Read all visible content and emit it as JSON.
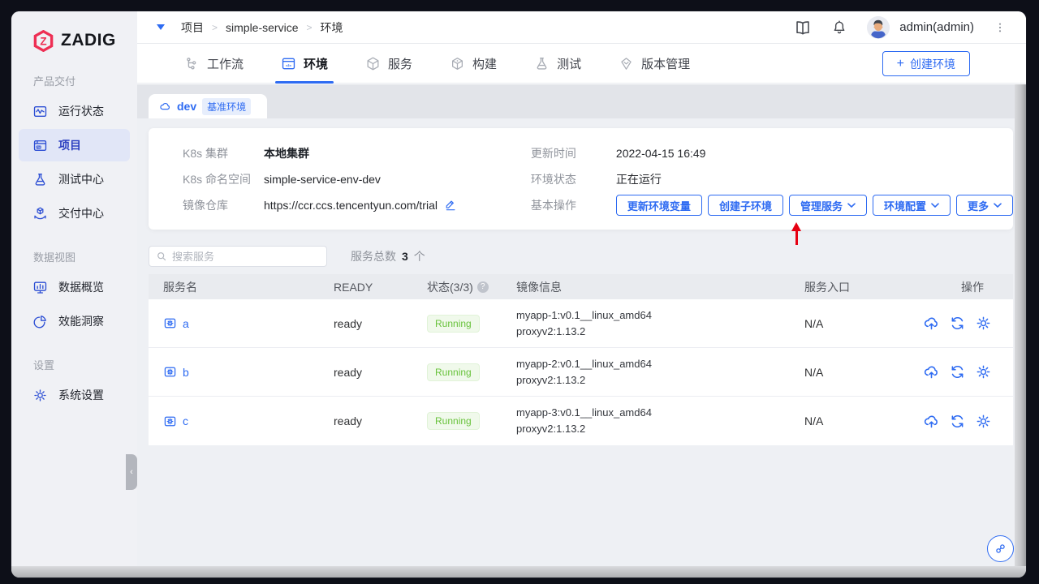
{
  "brand": {
    "name": "ZADIG",
    "logo_icon": "zadig-logo-icon",
    "logo_color": "#ee2f54"
  },
  "sidebar": {
    "sections": [
      {
        "title": "产品交付",
        "items": [
          {
            "icon": "monitor-wave-icon",
            "label": "运行状态",
            "active": false
          },
          {
            "icon": "project-icon",
            "label": "项目",
            "active": true
          },
          {
            "icon": "test-flask-icon",
            "label": "测试中心",
            "active": false
          },
          {
            "icon": "delivery-box-icon",
            "label": "交付中心",
            "active": false
          }
        ]
      },
      {
        "title": "数据视图",
        "items": [
          {
            "icon": "chart-monitor-icon",
            "label": "数据概览",
            "active": false
          },
          {
            "icon": "pie-chart-icon",
            "label": "效能洞察",
            "active": false
          }
        ]
      },
      {
        "title": "设置",
        "items": [
          {
            "icon": "gear-icon",
            "label": "系统设置",
            "active": false
          }
        ]
      }
    ],
    "collapse_icon": "chevron-left-icon"
  },
  "topbar": {
    "breadcrumb": {
      "caret_icon": "caret-down-icon",
      "items": [
        "项目",
        "simple-service",
        "环境"
      ]
    },
    "doc_icon": "docs-book-icon",
    "bell_icon": "notifications-bell-icon",
    "user": {
      "name": "admin(admin)",
      "avatar_icon": "user-avatar"
    },
    "more_icon": "kebab-menu-icon"
  },
  "tabs": {
    "items": [
      {
        "icon": "workflow-icon",
        "label": "工作流",
        "active": false
      },
      {
        "icon": "environment-icon",
        "label": "环境",
        "active": true
      },
      {
        "icon": "services-cube-icon",
        "label": "服务",
        "active": false
      },
      {
        "icon": "build-box-icon",
        "label": "构建",
        "active": false
      },
      {
        "icon": "test-flask-icon",
        "label": "测试",
        "active": false
      },
      {
        "icon": "version-gem-icon",
        "label": "版本管理",
        "active": false
      }
    ],
    "create_button": {
      "plus": "+",
      "label": "创建环境"
    }
  },
  "environment": {
    "tab": {
      "icon": "cloud-icon",
      "name": "dev",
      "badge": "基准环境"
    },
    "info_left": [
      {
        "label": "K8s 集群",
        "value": "本地集群"
      },
      {
        "label": "K8s 命名空间",
        "value": "simple-service-env-dev"
      },
      {
        "label": "镜像仓库",
        "value": "https://ccr.ccs.tencentyun.com/trial",
        "edit_icon": "edit-pencil-icon"
      }
    ],
    "info_right": [
      {
        "label": "更新时间",
        "value": "2022-04-15 16:49"
      },
      {
        "label": "环境状态",
        "value": "正在运行"
      }
    ],
    "actions_label": "基本操作",
    "actions": [
      {
        "label": "更新环境变量",
        "dropdown": false
      },
      {
        "label": "创建子环境",
        "dropdown": false,
        "pointed_by_red_arrow": true
      },
      {
        "label": "管理服务",
        "dropdown": true
      },
      {
        "label": "环境配置",
        "dropdown": true
      },
      {
        "label": "更多",
        "dropdown": true
      }
    ]
  },
  "service_toolbar": {
    "search_placeholder": "搜索服务",
    "search_icon": "search-icon",
    "total_label": "服务总数",
    "total_count": "3",
    "total_unit": "个"
  },
  "service_table": {
    "headers": [
      "服务名",
      "READY",
      "状态(3/3)",
      "镜像信息",
      "服务入口",
      "操作"
    ],
    "status_help": "?",
    "row_icon": "service-box-icon",
    "action_icons": [
      "cloud-upload-icon",
      "restart-icon",
      "config-gear-icon"
    ],
    "rows": [
      {
        "name": "a",
        "ready": "ready",
        "status": "Running",
        "image_1": "myapp-1:v0.1__linux_amd64",
        "image_2": "proxyv2:1.13.2",
        "entry": "N/A"
      },
      {
        "name": "b",
        "ready": "ready",
        "status": "Running",
        "image_1": "myapp-2:v0.1__linux_amd64",
        "image_2": "proxyv2:1.13.2",
        "entry": "N/A"
      },
      {
        "name": "c",
        "ready": "ready",
        "status": "Running",
        "image_1": "myapp-3:v0.1__linux_amd64",
        "image_2": "proxyv2:1.13.2",
        "entry": "N/A"
      }
    ]
  },
  "floating_button": {
    "icon": "share-link-icon"
  },
  "colors": {
    "accent_blue": "#2e6bf2",
    "logo_red": "#ee2f54",
    "running_text": "#67c23a",
    "running_bg": "#f0f9eb",
    "arrow_red": "#e60012",
    "sidebar_bg": "#f0f1f5",
    "content_bg": "#eef0f4"
  }
}
